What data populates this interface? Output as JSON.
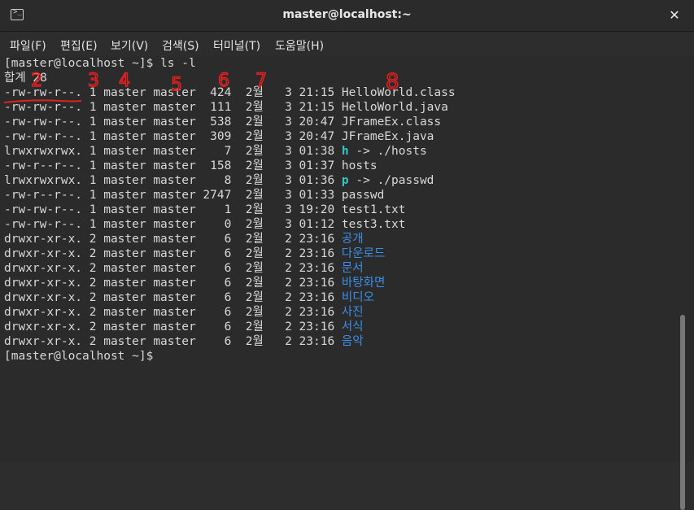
{
  "window": {
    "title": "master@localhost:~"
  },
  "menu": [
    "파일(F)",
    "편집(E)",
    "보기(V)",
    "검색(S)",
    "터미널(T)",
    "도움말(H)"
  ],
  "terminal": {
    "prompt": "[master@localhost ~]$ ls -l",
    "total": "합계 28",
    "files": [
      {
        "perm": "-rw-rw-r--.",
        "links": "1",
        "owner": "master",
        "group": "master",
        "size": "424",
        "month": "2월",
        "day": "3",
        "time": "21:15",
        "name": "HelloWorld.class",
        "kind": "file",
        "target": ""
      },
      {
        "perm": "-rw-rw-r--.",
        "links": "1",
        "owner": "master",
        "group": "master",
        "size": "111",
        "month": "2월",
        "day": "3",
        "time": "21:15",
        "name": "HelloWorld.java",
        "kind": "file",
        "target": ""
      },
      {
        "perm": "-rw-rw-r--.",
        "links": "1",
        "owner": "master",
        "group": "master",
        "size": "538",
        "month": "2월",
        "day": "3",
        "time": "20:47",
        "name": "JFrameEx.class",
        "kind": "file",
        "target": ""
      },
      {
        "perm": "-rw-rw-r--.",
        "links": "1",
        "owner": "master",
        "group": "master",
        "size": "309",
        "month": "2월",
        "day": "3",
        "time": "20:47",
        "name": "JFrameEx.java",
        "kind": "file",
        "target": ""
      },
      {
        "perm": "lrwxrwxrwx.",
        "links": "1",
        "owner": "master",
        "group": "master",
        "size": "7",
        "month": "2월",
        "day": "3",
        "time": "01:38",
        "name": "h",
        "kind": "link",
        "target": " -> ./hosts"
      },
      {
        "perm": "-rw-r--r--.",
        "links": "1",
        "owner": "master",
        "group": "master",
        "size": "158",
        "month": "2월",
        "day": "3",
        "time": "01:37",
        "name": "hosts",
        "kind": "file",
        "target": ""
      },
      {
        "perm": "lrwxrwxrwx.",
        "links": "1",
        "owner": "master",
        "group": "master",
        "size": "8",
        "month": "2월",
        "day": "3",
        "time": "01:36",
        "name": "p",
        "kind": "link",
        "target": " -> ./passwd"
      },
      {
        "perm": "-rw-r--r--.",
        "links": "1",
        "owner": "master",
        "group": "master",
        "size": "2747",
        "month": "2월",
        "day": "3",
        "time": "01:33",
        "name": "passwd",
        "kind": "file",
        "target": ""
      },
      {
        "perm": "-rw-rw-r--.",
        "links": "1",
        "owner": "master",
        "group": "master",
        "size": "1",
        "month": "2월",
        "day": "3",
        "time": "19:20",
        "name": "test1.txt",
        "kind": "file",
        "target": ""
      },
      {
        "perm": "-rw-rw-r--.",
        "links": "1",
        "owner": "master",
        "group": "master",
        "size": "0",
        "month": "2월",
        "day": "3",
        "time": "01:12",
        "name": "test3.txt",
        "kind": "file",
        "target": ""
      },
      {
        "perm": "drwxr-xr-x.",
        "links": "2",
        "owner": "master",
        "group": "master",
        "size": "6",
        "month": "2월",
        "day": "2",
        "time": "23:16",
        "name": "공개",
        "kind": "dir",
        "target": ""
      },
      {
        "perm": "drwxr-xr-x.",
        "links": "2",
        "owner": "master",
        "group": "master",
        "size": "6",
        "month": "2월",
        "day": "2",
        "time": "23:16",
        "name": "다운로드",
        "kind": "dir",
        "target": ""
      },
      {
        "perm": "drwxr-xr-x.",
        "links": "2",
        "owner": "master",
        "group": "master",
        "size": "6",
        "month": "2월",
        "day": "2",
        "time": "23:16",
        "name": "문서",
        "kind": "dir",
        "target": ""
      },
      {
        "perm": "drwxr-xr-x.",
        "links": "2",
        "owner": "master",
        "group": "master",
        "size": "6",
        "month": "2월",
        "day": "2",
        "time": "23:16",
        "name": "바탕화면",
        "kind": "dir",
        "target": ""
      },
      {
        "perm": "drwxr-xr-x.",
        "links": "2",
        "owner": "master",
        "group": "master",
        "size": "6",
        "month": "2월",
        "day": "2",
        "time": "23:16",
        "name": "비디오",
        "kind": "dir",
        "target": ""
      },
      {
        "perm": "drwxr-xr-x.",
        "links": "2",
        "owner": "master",
        "group": "master",
        "size": "6",
        "month": "2월",
        "day": "2",
        "time": "23:16",
        "name": "사진",
        "kind": "dir",
        "target": ""
      },
      {
        "perm": "drwxr-xr-x.",
        "links": "2",
        "owner": "master",
        "group": "master",
        "size": "6",
        "month": "2월",
        "day": "2",
        "time": "23:16",
        "name": "서식",
        "kind": "dir",
        "target": ""
      },
      {
        "perm": "drwxr-xr-x.",
        "links": "2",
        "owner": "master",
        "group": "master",
        "size": "6",
        "month": "2월",
        "day": "2",
        "time": "23:16",
        "name": "음악",
        "kind": "dir",
        "target": ""
      }
    ],
    "end_prompt": "[master@localhost ~]$ "
  },
  "annotations": {
    "color": "#e02020",
    "labels": [
      "2",
      "3",
      "4",
      "5",
      "6",
      "7",
      "8"
    ]
  }
}
